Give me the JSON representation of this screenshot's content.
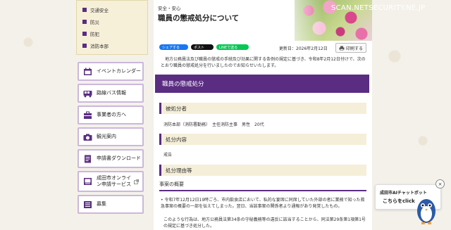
{
  "subnav": {
    "items": [
      "交通安全",
      "防災",
      "防犯",
      "消防本部"
    ]
  },
  "menu": {
    "items": [
      {
        "label": "イベントカレンダー",
        "icon": "calendar-icon"
      },
      {
        "label": "路線バス情報",
        "icon": "bus-icon"
      },
      {
        "label": "事業者の方へ",
        "icon": "business-icon"
      },
      {
        "label": "観光案内",
        "icon": "camera-icon"
      },
      {
        "label": "申請書ダウンロード",
        "icon": "document-icon"
      },
      {
        "label": "成田市オンライン申請サービス",
        "icon": "online-icon"
      },
      {
        "label": "募集",
        "icon": "recruit-icon"
      }
    ]
  },
  "header": {
    "category": "安全・安心",
    "title": "職員の懲戒処分について",
    "watermark": "SCAN.NETSECURITY.NE.JP"
  },
  "share": {
    "facebook": "シェアする",
    "x": "ポスト",
    "line": "LINEで送る"
  },
  "meta": {
    "updated": "更新日：2026年2月12日",
    "print": "印刷する"
  },
  "content": {
    "intro": "地方公務員法及び職員の懲戒の手続及び効果に関する条例の規定に基づき、令和8年2月12日付けで、次のとおり職員の懲戒処分を行いましたのでお知らせいたします。",
    "section_title": "職員の懲戒処分",
    "h_subject": "被処分者",
    "subject_text": "消防本部（消防署勤務）　主任消防主事　男性　20代",
    "h_action": "処分内容",
    "action_text": "戒告",
    "h_reason": "処分理由等",
    "h_summary": "事案の概要",
    "bullet1": "令和7年12月12日19時ごろ、市内飲食店において、私的な宴席に同席していた外部の者に業務で知った救急事案の概要の一部を伝えてしまった。翌日、当該事案の関係者より通報があり発覚したもの。",
    "bullet2": "このような行為は、地方公務員法第34条の守秘義務等の違反に該当することから、同法第29条第1項第1号の規定に基づき処分した。"
  },
  "chatbot": {
    "line1": "成田市AIチャットボット",
    "line2": "こちらをclick",
    "close": "×"
  },
  "colors": {
    "accent": "#5a2d82",
    "section_bg": "#f5efd9"
  }
}
